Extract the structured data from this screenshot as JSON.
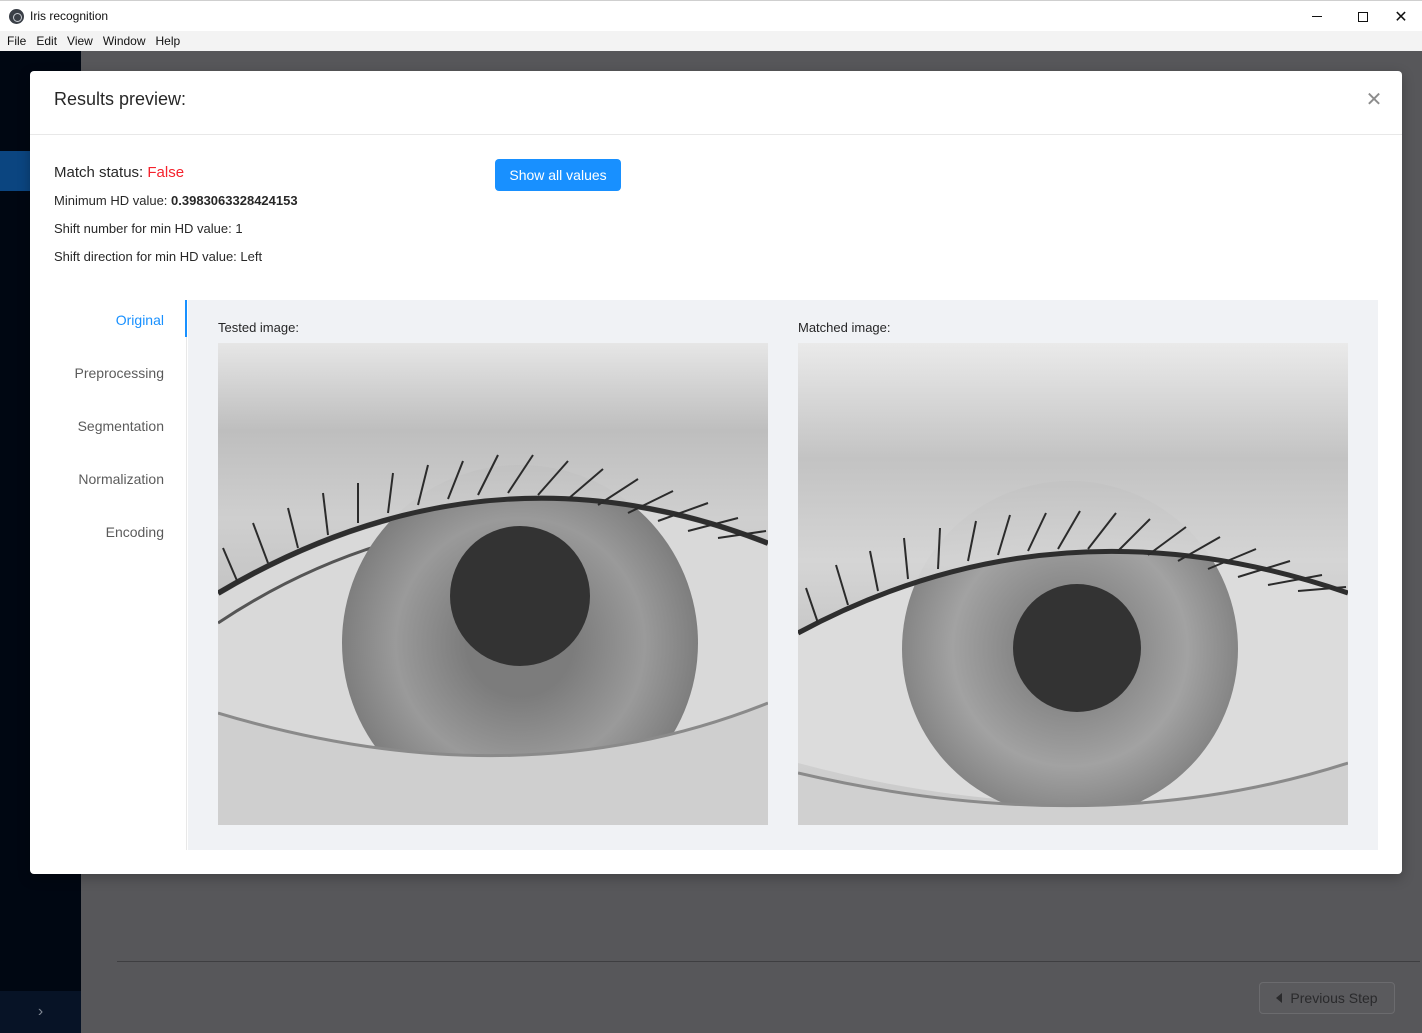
{
  "window": {
    "title": "Iris recognition",
    "menu": [
      "File",
      "Edit",
      "View",
      "Window",
      "Help"
    ]
  },
  "background": {
    "previous_step_label": "Previous Step"
  },
  "modal": {
    "title": "Results preview:",
    "match_status_label": "Match status:",
    "match_status_value": "False",
    "min_hd_label": "Minimum HD value:",
    "min_hd_value": "0.3983063328424153",
    "shift_number_text": "Shift number for min HD value: 1",
    "shift_direction_text": "Shift direction for min HD value: Left",
    "show_all_label": "Show all values",
    "tabs": [
      {
        "label": "Original",
        "active": true
      },
      {
        "label": "Preprocessing",
        "active": false
      },
      {
        "label": "Segmentation",
        "active": false
      },
      {
        "label": "Normalization",
        "active": false
      },
      {
        "label": "Encoding",
        "active": false
      }
    ],
    "tested_label": "Tested image:",
    "matched_label": "Matched image:"
  },
  "colors": {
    "primary": "#1890ff",
    "error": "#f5222d",
    "overlay": "#57575a"
  }
}
